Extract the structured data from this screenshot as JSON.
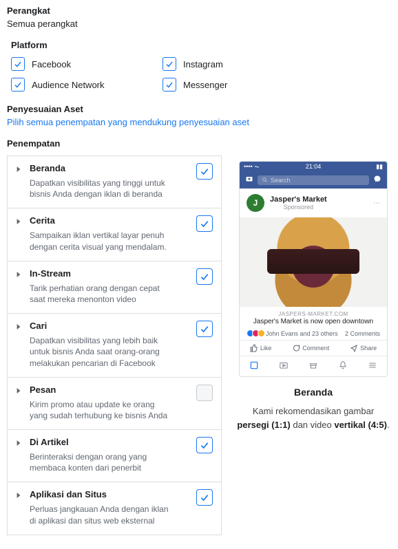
{
  "device": {
    "title": "Perangkat",
    "value": "Semua perangkat"
  },
  "platform": {
    "title": "Platform",
    "items": [
      {
        "label": "Facebook",
        "checked": true
      },
      {
        "label": "Instagram",
        "checked": true
      },
      {
        "label": "Audience Network",
        "checked": true
      },
      {
        "label": "Messenger",
        "checked": true
      }
    ]
  },
  "asset": {
    "title": "Penyesuaian Aset",
    "link": "Pilih semua penempatan yang mendukung penyesuaian aset"
  },
  "placements": {
    "title": "Penempatan",
    "items": [
      {
        "label": "Beranda",
        "desc": "Dapatkan visibilitas yang tinggi untuk bisnis Anda dengan iklan di beranda",
        "checked": true
      },
      {
        "label": "Cerita",
        "desc": "Sampaikan iklan vertikal layar penuh dengan cerita visual yang mendalam.",
        "checked": true
      },
      {
        "label": "In-Stream",
        "desc": "Tarik perhatian orang dengan cepat saat mereka menonton video",
        "checked": true
      },
      {
        "label": "Cari",
        "desc": "Dapatkan visibilitas yang lebih baik untuk bisnis Anda saat orang-orang melakukan pencarian di Facebook",
        "checked": true
      },
      {
        "label": "Pesan",
        "desc": "Kirim promo atau update ke orang yang sudah terhubung ke bisnis Anda",
        "checked": false
      },
      {
        "label": "Di Artikel",
        "desc": "Berinteraksi dengan orang yang membaca konten dari penerbit",
        "checked": true
      },
      {
        "label": "Aplikasi dan Situs",
        "desc": "Perluas jangkauan Anda dengan iklan di aplikasi dan situs web eksternal",
        "checked": true
      }
    ]
  },
  "preview": {
    "time": "21:04",
    "search_placeholder": "Search",
    "page_name": "Jasper's Market",
    "sponsored": "Sponsored",
    "caption_url": "JASPERS-MARKET.COM",
    "caption_text": "Jasper's Market is now open downtown",
    "reactions_text": "John Evans and 23 others",
    "comments_text": "2 Comments",
    "like_label": "Like",
    "comment_label": "Comment",
    "share_label": "Share",
    "title": "Beranda",
    "reco_pre": "Kami rekomendasikan gambar ",
    "reco_b1": "persegi (1:1)",
    "reco_mid": " dan video ",
    "reco_b2": "vertikal (4:5)",
    "reco_post": "."
  }
}
